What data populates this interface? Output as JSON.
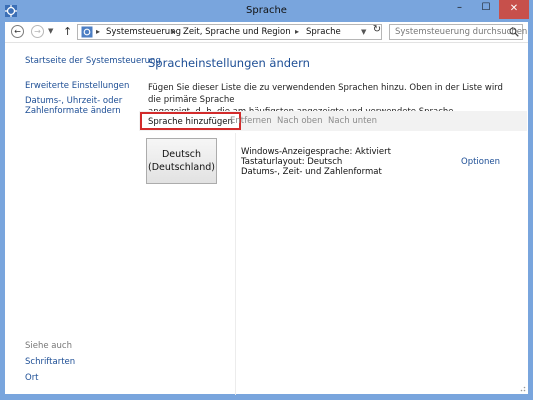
{
  "window": {
    "title": "Sprache"
  },
  "titlebar": {
    "minimize": "–",
    "maximize": "☐",
    "close": "✕"
  },
  "nav": {
    "crumbs": [
      "Systemsteuerung",
      "Zeit, Sprache und Region",
      "Sprache"
    ],
    "search_placeholder": "Systemsteuerung durchsuchen"
  },
  "left_pane": {
    "home_link": "Startseite der Systemsteuerung",
    "links": [
      "Erweiterte Einstellungen",
      "Datums-, Uhrzeit- oder",
      "Zahlenformate ändern"
    ],
    "see_also_label": "Siehe auch",
    "see_also": [
      "Schriftarten",
      "Ort"
    ]
  },
  "main": {
    "heading": "Spracheinstellungen ändern",
    "description_line1": "Fügen Sie dieser Liste die zu verwendenden Sprachen hinzu. Oben in der Liste wird die primäre Sprache",
    "description_line2": "angezeigt, d. h. die am häufigsten angezeigte und verwendete Sprache.",
    "toolbar": {
      "add": "Sprache hinzufügen",
      "remove": "Entfernen",
      "up": "Nach oben",
      "down": "Nach unten"
    },
    "languages": [
      {
        "name_line1": "Deutsch",
        "name_line2": "(Deutschland)",
        "details": [
          "Windows-Anzeigesprache: Aktiviert",
          "Tastaturlayout: Deutsch",
          "Datums-, Zeit- und Zahlenformat"
        ],
        "options": "Optionen"
      }
    ]
  },
  "colors": {
    "link": "#1d4e95",
    "close_button": "#c7504b",
    "highlight_border": "#d22b2b"
  }
}
